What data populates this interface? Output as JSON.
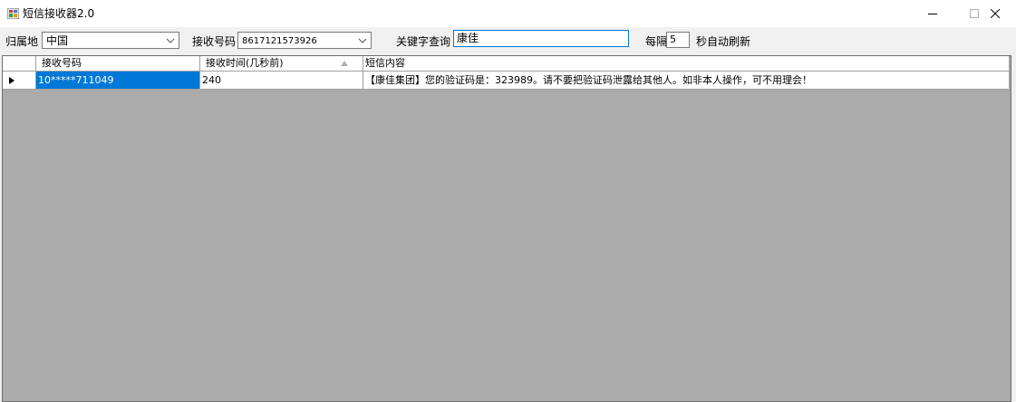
{
  "window": {
    "title": "短信接收器2.0"
  },
  "toolbar": {
    "region_label": "归属地",
    "region_value": "中国",
    "number_label": "接收号码",
    "number_value": "8617121573926",
    "keyword_label": "关键字查询",
    "keyword_value": "康佳",
    "interval_prefix": "每隔",
    "interval_value": "5",
    "interval_suffix": "秒自动刷新"
  },
  "grid": {
    "columns": [
      "接收号码",
      "接收时间(几秒前)",
      "短信内容"
    ],
    "rows": [
      {
        "number": "10*****711049",
        "seconds_ago": "240",
        "content": "【康佳集团】您的验证码是：323989。请不要把验证码泄露给其他人。如非本人操作，可不用理会！"
      }
    ]
  },
  "icons": {
    "app": "app-icon",
    "minimize": "minimize-icon",
    "maximize": "maximize-icon",
    "close": "close-icon",
    "dropdown": "chevron-down-icon",
    "sort": "sort-ascending-icon",
    "row_indicator": "row-pointer-icon"
  },
  "colors": {
    "selection": "#0078d7",
    "grid_background": "#ababab",
    "window_background": "#f0f0f0",
    "focus_border": "#0078d7"
  }
}
